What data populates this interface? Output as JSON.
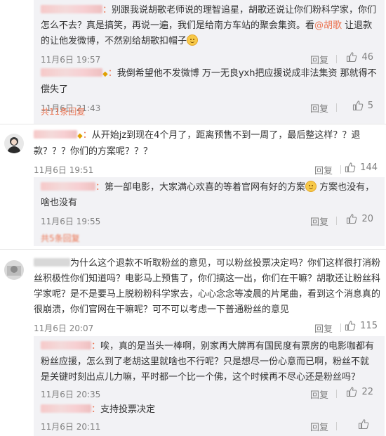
{
  "colors": {
    "accent": "#eb7350",
    "reply_bg": "#f2f2f5",
    "meta": "#808080"
  },
  "reply_label": "回复",
  "group1": {
    "replies": [
      {
        "text": "别跟我说胡歌老师说的理智追星，胡歌还说让你们粉科学家，你们怎么不去？真是搞笑，再说一遍，我们是给南方车站的聚会集资。看",
        "mention": "@胡歌",
        "text_after": " 让退款的让他发微博，不然别给胡歌扣帽子",
        "time": "11月6日 19:57",
        "likes": "46"
      },
      {
        "text": "我倒希望他不发微博 万一无良yxh把应援说成非法集资 那就得不偿失了",
        "time": "11月6日 21:43",
        "likes": "5"
      }
    ],
    "more": "共11条回复"
  },
  "comment2": {
    "text": "从开始jz到现在4个月了，距离预售不到一周了，最后整这样？？退款？？？你们的方案呢？？？",
    "time": "11月6日 19:51",
    "likes": "144"
  },
  "group2": {
    "replies": [
      {
        "text": "第一部电影，大家满心欢喜的等着官网有好的方案",
        "text_after": " 方案也没有，啥也没有",
        "time": "11月6日 19:55",
        "likes": "20"
      }
    ],
    "more": "共5条回复"
  },
  "comment3": {
    "text": "为什么这个退款不听取粉丝的意见，可以粉丝投票决定吗？你们这样很打消粉丝积极性你们知道吗？电影马上预售了，你们搞这一出，你们在干嘛？胡歌还让粉丝科学家呢？是不是要马上脱粉粉科学家去，心心念念等凌晨的片尾曲，看到这个消息真的很崩溃，你们官网在干嘛呢？可不可以考虑一下普通粉丝的意见",
    "time": "11月6日 20:07",
    "likes": "115"
  },
  "group3": {
    "replies": [
      {
        "text": "唉，真的是当头一棒啊，别家再大牌再有国民度有票房的电影咖都有粉丝应援，怎么到了老胡这里就啥也不行呢？只是想尽一份心意而已啊，粉丝不就是关键时刻出点儿力嘛，平时都一个比一个佛，这个时候再不尽心还是粉丝吗？",
        "time": "11月6日 20:35",
        "likes": "22"
      },
      {
        "text": "支持投票决定",
        "time": "11月6日 20:11",
        "likes": ""
      }
    ]
  }
}
